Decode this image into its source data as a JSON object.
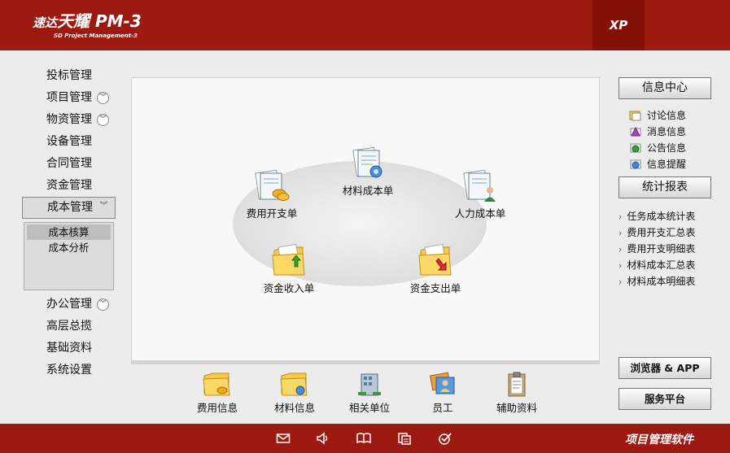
{
  "header": {
    "brand_small": "速达",
    "brand_big": "天耀 PM-3",
    "brand_sub": "SD Project Management-3",
    "edition": "XP"
  },
  "nav": {
    "items": [
      {
        "label": "投标管理"
      },
      {
        "label": "项目管理"
      },
      {
        "label": "物资管理"
      },
      {
        "label": "设备管理"
      },
      {
        "label": "合同管理"
      },
      {
        "label": "资金管理"
      },
      {
        "label": "成本管理"
      }
    ],
    "sub_items": [
      {
        "label": "成本核算"
      },
      {
        "label": "成本分析"
      }
    ],
    "items_after": [
      {
        "label": "办公管理"
      },
      {
        "label": "高层总揽"
      },
      {
        "label": "基础资料"
      },
      {
        "label": "系统设置"
      }
    ]
  },
  "main": {
    "nodes": {
      "material_cost": "材料成本单",
      "expense": "费用开支单",
      "labor_cost": "人力成本单",
      "fund_income": "资金收入单",
      "fund_expense": "资金支出单"
    }
  },
  "right": {
    "info_center": "信息中心",
    "info_items": [
      {
        "label": "讨论信息",
        "icon": "discussion-icon"
      },
      {
        "label": "消息信息",
        "icon": "message-icon"
      },
      {
        "label": "公告信息",
        "icon": "announcement-icon"
      },
      {
        "label": "信息提醒",
        "icon": "reminder-icon"
      }
    ],
    "stats_report": "统计报表",
    "report_items": [
      {
        "label": "任务成本统计表"
      },
      {
        "label": "费用开支汇总表"
      },
      {
        "label": "费用开支明细表"
      },
      {
        "label": "材料成本汇总表"
      },
      {
        "label": "材料成本明细表"
      }
    ],
    "browser_app": "浏览器 & APP",
    "service_platform": "服务平台"
  },
  "bottom": {
    "items": [
      {
        "label": "费用信息"
      },
      {
        "label": "材料信息"
      },
      {
        "label": "相关单位"
      },
      {
        "label": "员工"
      },
      {
        "label": "辅助资料"
      }
    ]
  },
  "footer": {
    "title": "项目管理软件"
  },
  "colors": {
    "brand_red": "#9c1a12",
    "brand_red_dark": "#831108"
  }
}
